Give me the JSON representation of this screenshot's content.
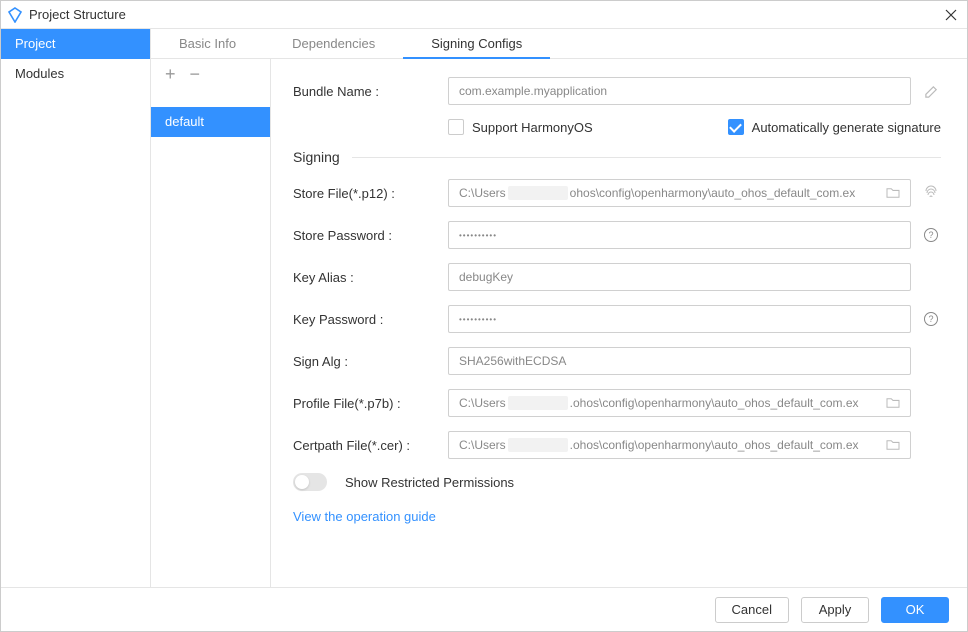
{
  "window": {
    "title": "Project Structure"
  },
  "sidebar": {
    "items": [
      {
        "label": "Project",
        "active": true
      },
      {
        "label": "Modules",
        "active": false
      }
    ]
  },
  "tabs": [
    {
      "label": "Basic Info",
      "active": false
    },
    {
      "label": "Dependencies",
      "active": false
    },
    {
      "label": "Signing Configs",
      "active": true
    }
  ],
  "configs": {
    "items": [
      {
        "label": "default",
        "active": true
      }
    ]
  },
  "form": {
    "bundle_name_label": "Bundle Name :",
    "bundle_name_value": "com.example.myapplication",
    "support_harmonyos_label": "Support HarmonyOS",
    "support_harmonyos_checked": false,
    "auto_sign_label": "Automatically generate signature",
    "auto_sign_checked": true,
    "section_signing": "Signing",
    "store_file_label": "Store File(*.p12) :",
    "store_file_start": "C:\\Users",
    "store_file_end": "ohos\\config\\openharmony\\auto_ohos_default_com.ex",
    "store_password_label": "Store Password :",
    "store_password_value": "••••••••••",
    "key_alias_label": "Key Alias :",
    "key_alias_value": "debugKey",
    "key_password_label": "Key Password :",
    "key_password_value": "••••••••••",
    "sign_alg_label": "Sign Alg :",
    "sign_alg_value": "SHA256withECDSA",
    "profile_file_label": "Profile File(*.p7b) :",
    "profile_file_start": "C:\\Users",
    "profile_file_end": ".ohos\\config\\openharmony\\auto_ohos_default_com.ex",
    "certpath_file_label": "Certpath File(*.cer) :",
    "certpath_file_start": "C:\\Users",
    "certpath_file_end": ".ohos\\config\\openharmony\\auto_ohos_default_com.ex",
    "restricted_perms_label": "Show Restricted Permissions",
    "restricted_perms_on": false,
    "operation_guide_label": "View the operation guide"
  },
  "footer": {
    "cancel": "Cancel",
    "apply": "Apply",
    "ok": "OK"
  }
}
